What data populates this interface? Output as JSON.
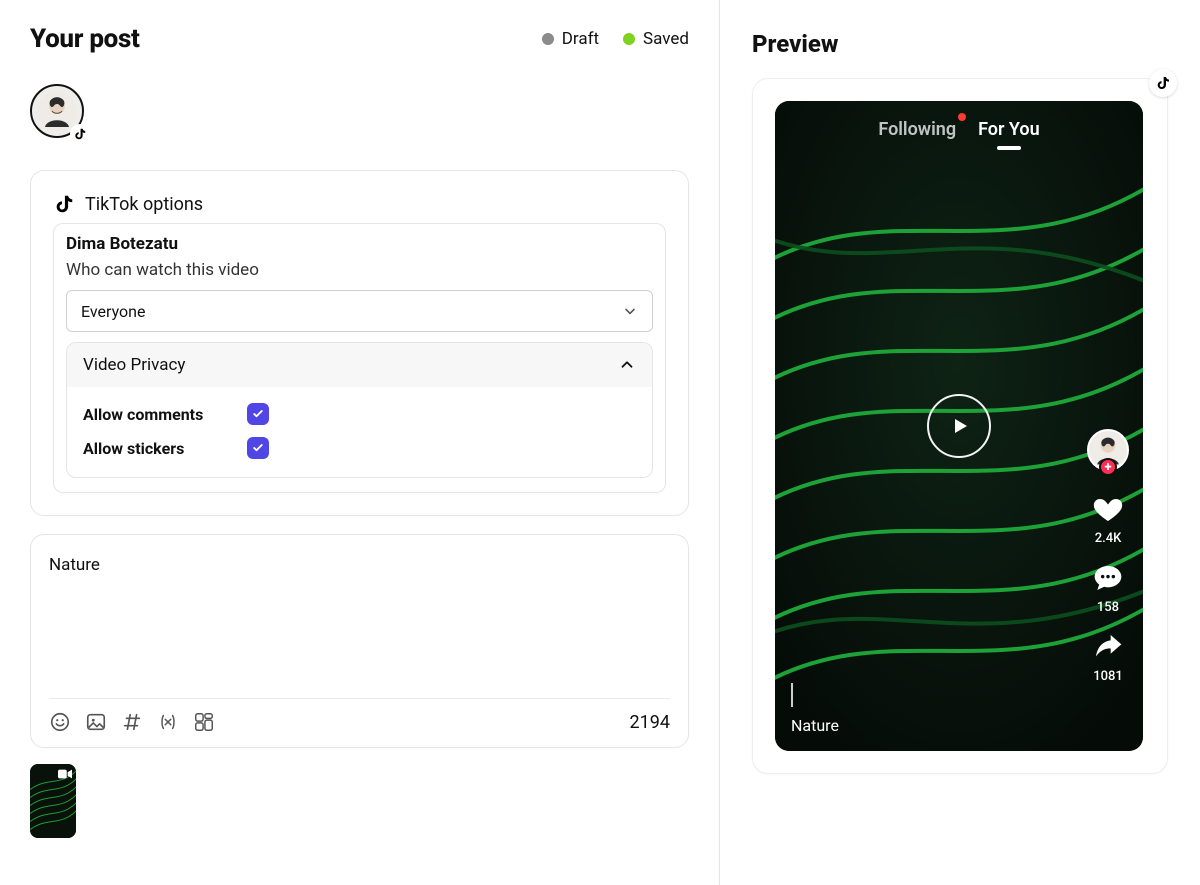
{
  "header": {
    "title": "Your post",
    "draft_label": "Draft",
    "saved_label": "Saved"
  },
  "account": {
    "name": "Dima Botezatu"
  },
  "options": {
    "title": "TikTok options",
    "visibility_label": "Who can watch this video",
    "visibility_value": "Everyone",
    "privacy_section_label": "Video Privacy",
    "allow_comments_label": "Allow comments",
    "allow_comments_checked": true,
    "allow_stickers_label": "Allow stickers",
    "allow_stickers_checked": true
  },
  "caption": {
    "text": "Nature",
    "char_counter": "2194"
  },
  "preview": {
    "heading": "Preview",
    "tabs": {
      "following": "Following",
      "for_you": "For You"
    },
    "likes": "2.4K",
    "comments": "158",
    "shares": "1081",
    "caption": "Nature"
  }
}
